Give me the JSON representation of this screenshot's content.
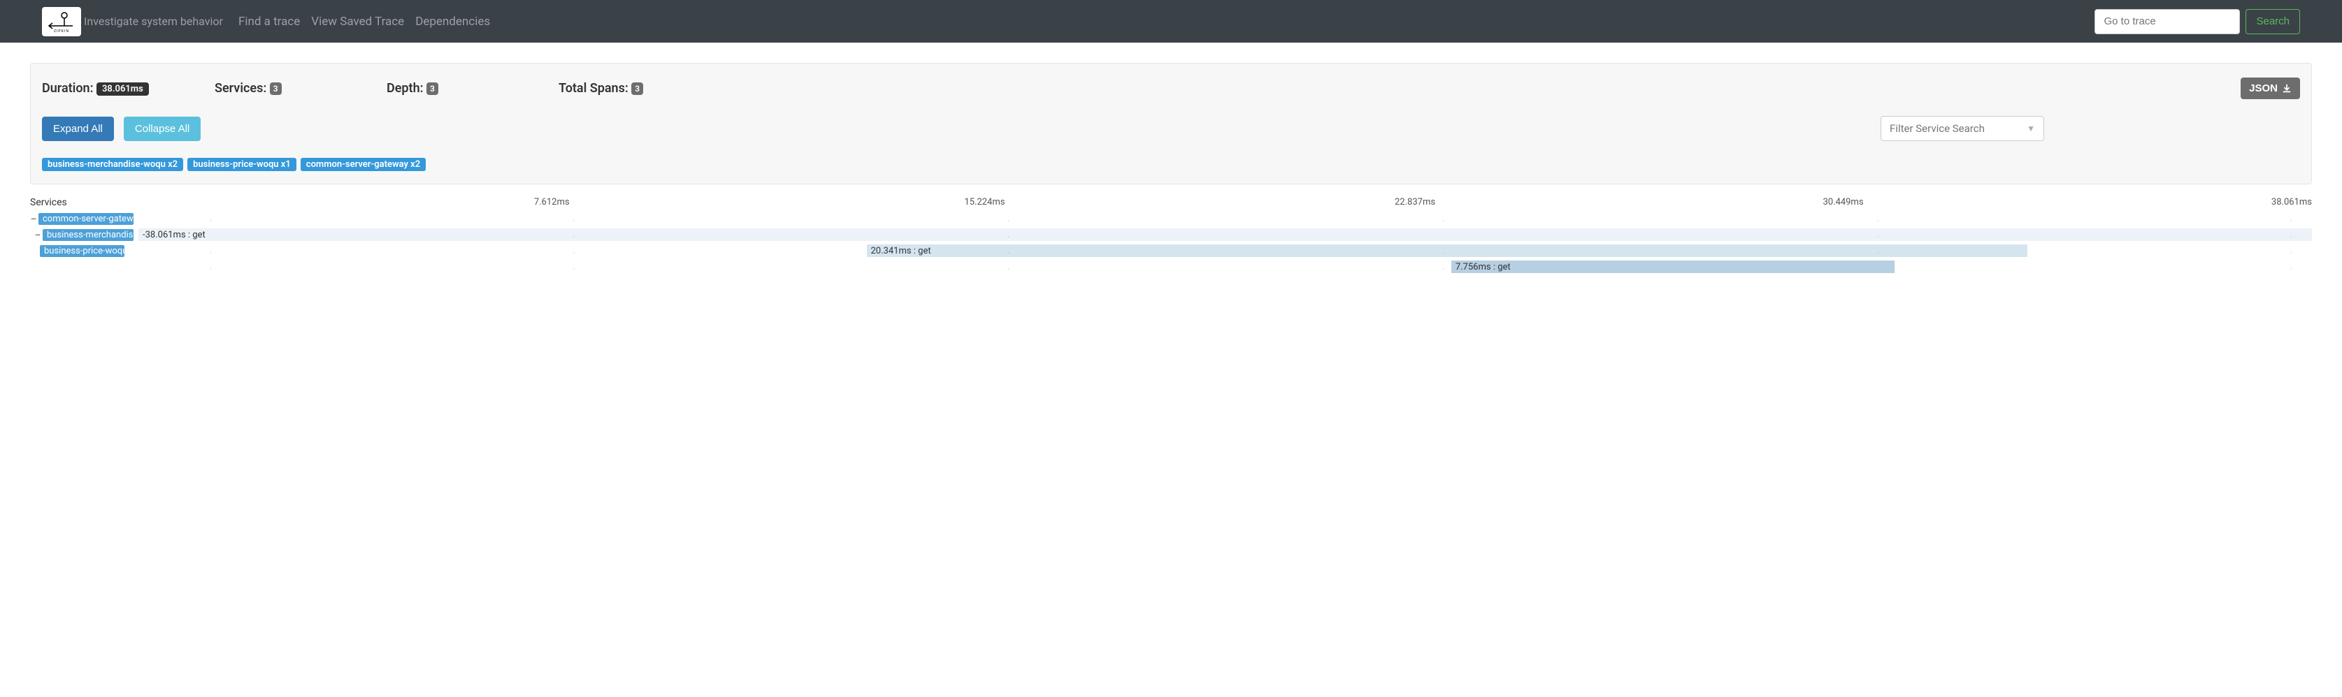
{
  "nav": {
    "tagline": "Investigate system behavior",
    "links": [
      "Find a trace",
      "View Saved Trace",
      "Dependencies"
    ],
    "goto_placeholder": "Go to trace",
    "search_label": "Search"
  },
  "summary": {
    "duration_label": "Duration:",
    "duration_value": "38.061ms",
    "services_label": "Services:",
    "services_count": "3",
    "depth_label": "Depth:",
    "depth_count": "3",
    "spans_label": "Total Spans:",
    "spans_count": "3",
    "json_label": "JSON"
  },
  "controls": {
    "expand_label": "Expand All",
    "collapse_label": "Collapse All",
    "filter_placeholder": "Filter Service Search"
  },
  "tags": [
    "business-merchandise-woqu x2",
    "business-price-woqu x1",
    "common-server-gateway x2"
  ],
  "timeline": {
    "services_header": "Services",
    "markers": [
      "7.612ms",
      "15.224ms",
      "22.837ms",
      "30.449ms",
      "38.061ms"
    ]
  },
  "spans": [
    {
      "label": "common-server-gateway",
      "text": "-38.061ms : get"
    },
    {
      "label": "business-merchandise-woqu",
      "text": "20.341ms : get"
    },
    {
      "label": "business-price-woqu",
      "text": "7.756ms : get"
    }
  ]
}
